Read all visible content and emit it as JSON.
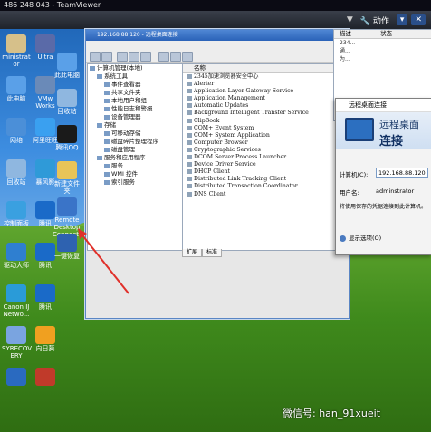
{
  "teamviewer": {
    "title": "486 248 043 - TeamViewer",
    "actions_label": "动作",
    "close_label": "✕"
  },
  "desktop": {
    "icons": [
      {
        "label": "ministrat or",
        "icon": "user-icon",
        "color": "#d6c08a"
      },
      {
        "label": "此电脑",
        "icon": "computer-icon",
        "color": "#5aa0e8"
      },
      {
        "label": "网络",
        "icon": "network-icon",
        "color": "#4b8fd8"
      },
      {
        "label": "回收站",
        "icon": "recycle-bin-icon",
        "color": "#8fb7e0"
      },
      {
        "label": "控制面板",
        "icon": "control-panel-icon",
        "color": "#3aa0e0"
      },
      {
        "label": "驱动大师",
        "icon": "driver-icon",
        "color": "#2f7fd0"
      },
      {
        "label": "Canon IJ Netwo...",
        "icon": "canon-icon",
        "color": "#2a9bd8"
      },
      {
        "label": "SYRECOV ERY",
        "icon": "recovery-icon",
        "color": "#7aa4e0"
      },
      {
        "label": "",
        "icon": "app-icon",
        "color": "#2a6ac0"
      }
    ],
    "icons_col2": [
      {
        "label": "Ultra",
        "icon": "ultra-icon",
        "color": "#5a6aa8"
      },
      {
        "label": "VMw Works",
        "icon": "vmware-icon",
        "color": "#6a8ab8"
      },
      {
        "label": "阿里旺旺",
        "icon": "aliwangwang-icon",
        "color": "#3aa0f0"
      },
      {
        "label": "暴风影",
        "icon": "storm-icon",
        "color": "#2f9ad8"
      },
      {
        "label": "腾讯",
        "icon": "tencent-icon",
        "color": "#1a6ac8"
      },
      {
        "label": "腾讯",
        "icon": "tencent-icon",
        "color": "#1a6ac8"
      },
      {
        "label": "腾讯",
        "icon": "tencent-icon",
        "color": "#1a6ac8"
      },
      {
        "label": "向日葵",
        "icon": "sunflower-icon",
        "color": "#f0a020"
      },
      {
        "label": "",
        "icon": "app-icon",
        "color": "#c03a2a"
      }
    ],
    "icons_col3": [
      {
        "label": "此此电脑",
        "icon": "computer-icon",
        "color": "#5aa0e8"
      },
      {
        "label": "回收站",
        "icon": "recycle-bin-icon",
        "color": "#8fb7e0"
      },
      {
        "label": "腾讯QQ",
        "icon": "qq-icon",
        "color": "#1a1a1a"
      },
      {
        "label": "新建文件夹",
        "icon": "folder-icon",
        "color": "#e8c458"
      },
      {
        "label": "Remote Desktop Connection",
        "icon": "rdp-icon",
        "color": "#3a74c8"
      },
      {
        "label": "一键恢复",
        "icon": "restore-icon",
        "color": "#2e62b0"
      }
    ]
  },
  "window": {
    "title": "192.168.88.120 - 远程桌面连接",
    "tree": [
      {
        "label": "计算机管理(本地)",
        "indent": 0
      },
      {
        "label": "系统工具",
        "indent": 1
      },
      {
        "label": "事件查看器",
        "indent": 2
      },
      {
        "label": "共享文件夹",
        "indent": 2
      },
      {
        "label": "本地用户和组",
        "indent": 2
      },
      {
        "label": "性能日志和警报",
        "indent": 2
      },
      {
        "label": "设备管理器",
        "indent": 2
      },
      {
        "label": "存储",
        "indent": 1
      },
      {
        "label": "可移动存储",
        "indent": 2
      },
      {
        "label": "磁盘碎片整理程序",
        "indent": 2
      },
      {
        "label": "磁盘管理",
        "indent": 2
      },
      {
        "label": "服务和应用程序",
        "indent": 1
      },
      {
        "label": "服务",
        "indent": 2
      },
      {
        "label": "WMI 控件",
        "indent": 2
      },
      {
        "label": "索引服务",
        "indent": 2
      }
    ],
    "list_header": "名称",
    "services": [
      "2345加速浏览器安全中心",
      "Alerter",
      "Application Layer Gateway Service",
      "Application Management",
      "Automatic Updates",
      "Background Intelligent Transfer Service",
      "ClipBook",
      "COM+ Event System",
      "COM+ System Application",
      "Computer Browser",
      "Cryptographic Services",
      "DCOM Server Process Launcher",
      "Device Driver Service",
      "DHCP Client",
      "Distributed Link Tracking Client",
      "Distributed Transaction Coordinator",
      "DNS Client"
    ],
    "tabs": [
      "扩展",
      "标准"
    ]
  },
  "side_panel": {
    "header_desc": "描述",
    "header_status": "状态",
    "rows": [
      "234...",
      "通...",
      "为...",
      ""
    ]
  },
  "rdp_dialog": {
    "title": "远程桌面连接",
    "banner_line1": "远程桌面",
    "banner_line2": "连接",
    "computer_label": "计算机(C):",
    "computer_value": "192.168.88.120",
    "username_label": "用户名:",
    "username_value": "adminstrator",
    "note": "将使用保存的凭据连接到此计算机。",
    "options_label": "显示选项(O)"
  },
  "watermark": "微信号: han_91xueit"
}
